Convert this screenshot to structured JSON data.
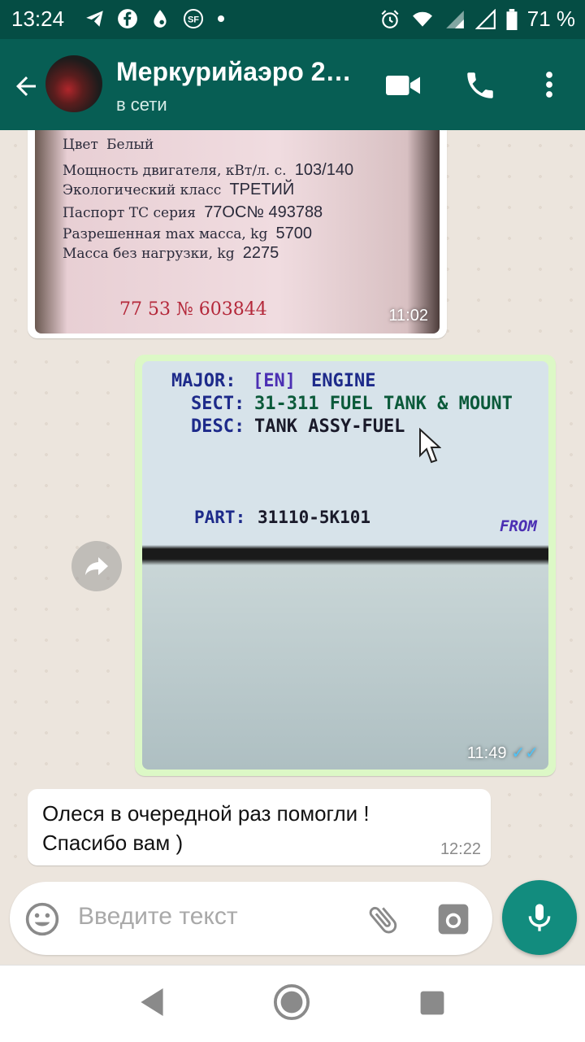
{
  "status_bar": {
    "time": "13:24",
    "battery": "71 %",
    "left_icons": [
      "telegram-icon",
      "facebook-icon",
      "water-drop-icon",
      "sf-icon",
      "dot-icon"
    ],
    "right_icons": [
      "alarm-icon",
      "wifi-icon",
      "signal-icon",
      "signal-empty-icon",
      "battery-icon"
    ]
  },
  "header": {
    "title": "Меркурийаэро 2…",
    "subtitle": "в сети"
  },
  "messages": {
    "image1": {
      "time": "11:02",
      "doc_lines": [
        {
          "label": "Цвет",
          "value": "Белый"
        },
        {
          "label": "Мощность двигателя, кВт/л. с.",
          "value": "103/140"
        },
        {
          "label": "Экологический класс",
          "value": "ТРЕТИЙ"
        },
        {
          "label": "Паспорт ТС серия",
          "value": "77ОС№  493788"
        },
        {
          "label": "Разрешенная max масса, kg",
          "value": "5700"
        },
        {
          "label": "Масса без нагрузки, kg",
          "value": "2275"
        }
      ],
      "serial": "77 53 № 603844"
    },
    "image2": {
      "time": "11:49",
      "screen": {
        "major_label": "MAJOR:",
        "major_code": "[EN]",
        "major_value": "ENGINE",
        "sect_label": "SECT:",
        "sect_value": "31-311  FUEL TANK & MOUNT",
        "desc_label": "DESC:",
        "desc_value": "TANK ASSY-FUEL",
        "part_label": "PART:",
        "part_value": "31110-5K101",
        "from_label": "FROM"
      }
    },
    "text1": {
      "line1": "Олеся в очередной раз помогли !",
      "line2": "Спасибо вам )",
      "time": "12:22"
    }
  },
  "input": {
    "placeholder": "Введите текст"
  },
  "colors": {
    "header": "#075e54",
    "status": "#054d44",
    "outgoing": "#dcf8c6",
    "incoming": "#ffffff",
    "accent": "#128c7e",
    "read_ticks": "#4fc3f7"
  }
}
